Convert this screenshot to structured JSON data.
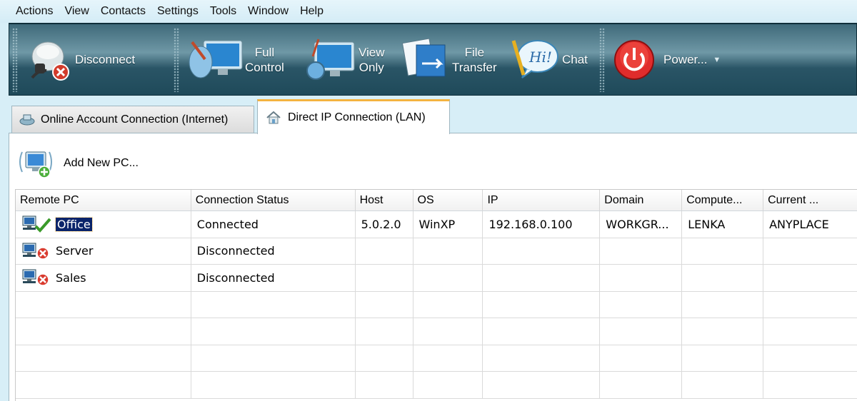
{
  "menu": [
    "Actions",
    "View",
    "Contacts",
    "Settings",
    "Tools",
    "Window",
    "Help"
  ],
  "toolbar": {
    "disconnect": "Disconnect",
    "full_control": [
      "Full",
      "Control"
    ],
    "view_only": [
      "View",
      "Only"
    ],
    "file_transfer": [
      "File",
      "Transfer"
    ],
    "chat": "Chat",
    "power": "Power..."
  },
  "tabs": {
    "online": "Online Account Connection (Internet)",
    "direct": "Direct IP Connection (LAN)"
  },
  "add_pc": "Add New PC...",
  "table": {
    "columns": [
      "Remote PC",
      "Connection Status",
      "Host",
      "OS",
      "IP",
      "Domain",
      "Compute...",
      "Current ..."
    ],
    "rows": [
      {
        "name": "Office",
        "status": "Connected",
        "host": "5.0.2.0",
        "os": "WinXP",
        "ip": "192.168.0.100",
        "domain": "WORKGR...",
        "computer": "LENKA",
        "current": "ANYPLACE",
        "state": "connected"
      },
      {
        "name": "Server",
        "status": "Disconnected",
        "host": "",
        "os": "",
        "ip": "",
        "domain": "",
        "computer": "",
        "current": "",
        "state": "disconnected"
      },
      {
        "name": "Sales",
        "status": "Disconnected",
        "host": "",
        "os": "",
        "ip": "",
        "domain": "",
        "computer": "",
        "current": "",
        "state": "disconnected"
      }
    ]
  },
  "colors": {
    "accent_tab": "#f4b340",
    "toolbar": "#2a5566",
    "selection": "#0a246a"
  }
}
